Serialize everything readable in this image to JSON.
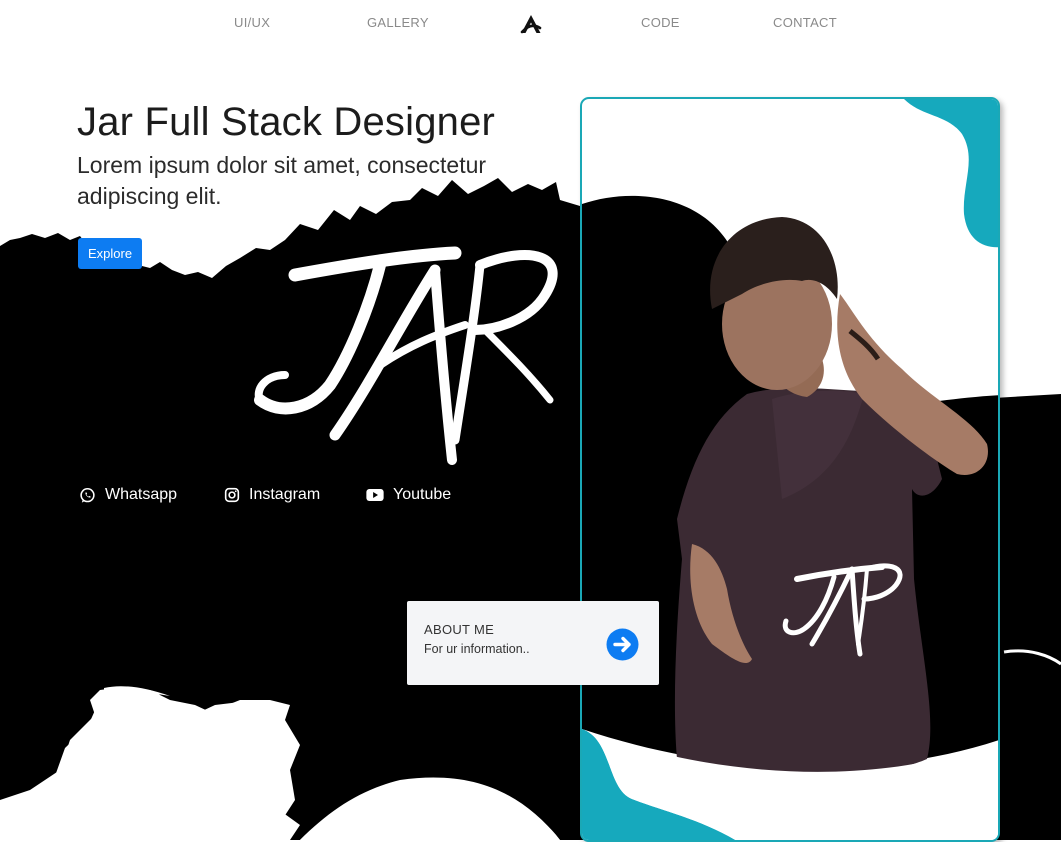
{
  "nav": {
    "items": [
      {
        "id": "uiux",
        "label": "UI/UX"
      },
      {
        "id": "gallery",
        "label": "GALLERY"
      },
      {
        "id": "code",
        "label": "CODE"
      },
      {
        "id": "contact",
        "label": "CONTACT"
      }
    ],
    "logo_icon": "triangle-a-logo-icon"
  },
  "hero": {
    "title": "Jar Full Stack Designer",
    "subtitle": "Lorem ipsum dolor sit amet, consectetur adipiscing elit.",
    "explore_label": "Explore"
  },
  "signature_text": "JAR",
  "social": [
    {
      "label": "Whatsapp",
      "icon": "whatsapp-icon"
    },
    {
      "label": "Instagram",
      "icon": "instagram-icon"
    },
    {
      "label": "Youtube",
      "icon": "youtube-icon"
    }
  ],
  "about": {
    "title": "ABOUT ME",
    "description": "For ur information..",
    "arrow_icon": "arrow-right-circle-icon"
  },
  "colors": {
    "accent_teal": "#1aa8b6",
    "button_blue": "#0d7cf2",
    "ink": "#000000",
    "shirt": "#3b2a33"
  }
}
